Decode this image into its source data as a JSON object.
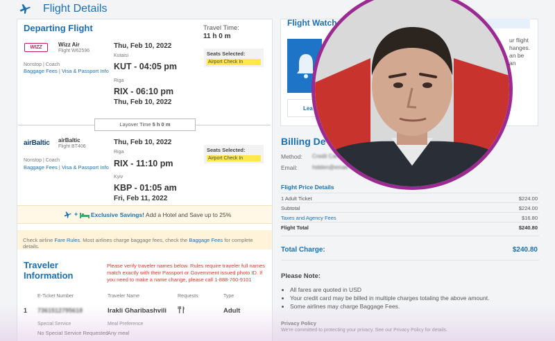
{
  "header": {
    "title": "Flight Details"
  },
  "departing": {
    "heading": "Departing Flight",
    "travel_time_label": "Travel Time:",
    "travel_time": "11 h 0 m",
    "segments": [
      {
        "airline_logo": "WIZZ",
        "airline": "Wizz Air",
        "flight": "Flight W62596",
        "class": "Nonstop | Coach",
        "baggage_link": "Baggage Fees",
        "visa_link": "Visa & Passport Info",
        "dep_date": "Thu, Feb 10, 2022",
        "dep_city": "Kutaisi",
        "dep_code_time": "KUT - 04:05 pm",
        "arr_city": "Riga",
        "arr_code_time": "RIX - 06:10 pm",
        "arr_date": "Thu, Feb 10, 2022",
        "seats_label": "Seats Selected:",
        "seats_value": "Airport Check In"
      },
      {
        "airline_logo": "airBaltic",
        "airline": "airBaltic",
        "flight": "Flight BT406",
        "class": "Nonstop | Coach",
        "baggage_link": "Baggage Fees",
        "visa_link": "Visa & Passport Info",
        "dep_date": "Thu, Feb 10, 2022",
        "dep_city": "Riga",
        "dep_code_time": "RIX - 11:10 pm",
        "arr_city": "Kyiv",
        "arr_code_time": "KBP - 01:05 am",
        "arr_date": "Fri, Feb 11, 2022",
        "seats_label": "Seats Selected:",
        "seats_value": "Airport Check In"
      }
    ],
    "layover_label": "Layover Time",
    "layover_time": "5 h 0 m"
  },
  "savings": {
    "bold": "Exclusive Savings!",
    "text": "Add a Hotel and Save up to 25%"
  },
  "baggage_note": {
    "pre": "Check airline",
    "link1": "Fare Rules",
    "mid": ". Most airlines charge baggage fees, check the",
    "link2": "Baggage Fees",
    "post": "for complete details."
  },
  "traveler": {
    "heading_line1": "Traveler",
    "heading_line2": "Information",
    "warning": "Please verify traveler names below. Rules require traveler full names match exactly with their Passport or Government issued photo ID. If you need to make a name change, please call 1-888-760-9101",
    "columns": [
      "E-Ticket Number",
      "Traveler Name",
      "Requests",
      "Type"
    ],
    "row": {
      "index": "1",
      "ticket": "7361512795618",
      "name": "Irakli Gharibashvili",
      "type": "Adult"
    },
    "special_label": "Special Service",
    "special_value": "No Special Service Requested",
    "meal_label": "Meal Preference",
    "meal_value": "Any meal"
  },
  "flight_watch": {
    "heading": "Flight Watch",
    "side_text": [
      "ur flight",
      "hanges.",
      "an be",
      "an"
    ],
    "learn_button": "Lea"
  },
  "billing": {
    "heading": "Billing De",
    "method_label": "Method:",
    "method_value": "Credit Card",
    "email_label": "Email:",
    "email_value": "hidden@email"
  },
  "price": {
    "heading": "Flight Price Details",
    "rows": [
      {
        "label": "1 Adult Ticket",
        "value": "$224.00"
      },
      {
        "label": "Subtotal",
        "value": "$224.00"
      },
      {
        "label": "Taxes and Agency Fees",
        "value": "$16.80"
      },
      {
        "label": "Flight Total",
        "value": "$240.80"
      }
    ],
    "total_label": "Total Charge:",
    "total_value": "$240.80"
  },
  "note": {
    "heading": "Please Note:",
    "items": [
      "All fares are quoted in USD",
      "Your credit card may be billed in multiple charges totaling the above amount.",
      "Some airlines may charge Baggage Fees."
    ],
    "privacy_heading": "Privacy Policy",
    "privacy_text": "We're committed to protecting your privacy. See our Privacy Policy for details."
  },
  "colors": {
    "accent": "#1a6fb3",
    "warning": "#e0352b",
    "highlight": "#ffe84d",
    "avatar_ring": "#9b2a92"
  }
}
